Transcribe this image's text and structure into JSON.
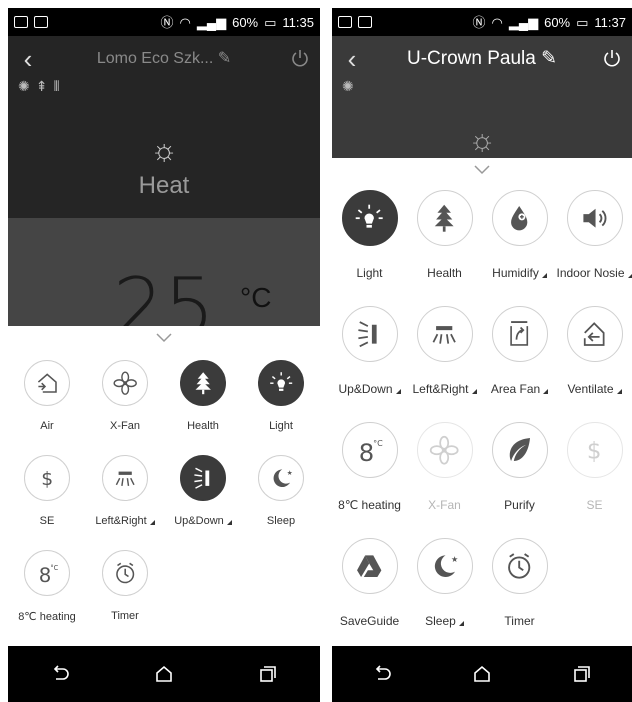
{
  "left": {
    "status": {
      "battery": "60%",
      "time": "11:35"
    },
    "device_title": "Lomo Eco Szk...",
    "mode": "Heat",
    "temperature": {
      "value": "25",
      "unit": "°C"
    },
    "functions": [
      {
        "label": "Air",
        "icon": "air-house-icon",
        "state": "normal"
      },
      {
        "label": "X-Fan",
        "icon": "fan-icon",
        "state": "normal"
      },
      {
        "label": "Health",
        "icon": "tree-icon",
        "state": "active"
      },
      {
        "label": "Light",
        "icon": "bulb-icon",
        "state": "active"
      },
      {
        "label": "SE",
        "icon": "dollar-icon",
        "state": "normal"
      },
      {
        "label": "Left&Right",
        "icon": "swing-horizontal-icon",
        "state": "normal",
        "dropdown": true
      },
      {
        "label": "Up&Down",
        "icon": "swing-vertical-icon",
        "state": "active",
        "dropdown": true
      },
      {
        "label": "Sleep",
        "icon": "moon-icon",
        "state": "normal"
      },
      {
        "label": "8℃ heating",
        "icon": "eight-degree-icon",
        "state": "normal"
      },
      {
        "label": "Timer",
        "icon": "clock-icon",
        "state": "normal"
      }
    ]
  },
  "right": {
    "status": {
      "battery": "60%",
      "time": "11:37"
    },
    "device_title": "U-Crown Paula",
    "functions": [
      {
        "label": "Light",
        "icon": "bulb-icon",
        "state": "active"
      },
      {
        "label": "Health",
        "icon": "tree-icon",
        "state": "normal"
      },
      {
        "label": "Humidify",
        "icon": "drop-icon",
        "state": "normal",
        "dropdown": true
      },
      {
        "label": "Indoor Nosie",
        "icon": "speaker-icon",
        "state": "normal",
        "dropdown": true
      },
      {
        "label": "Up&Down",
        "icon": "swing-vertical-icon",
        "state": "normal",
        "dropdown": true
      },
      {
        "label": "Left&Right",
        "icon": "swing-horizontal-icon",
        "state": "normal",
        "dropdown": true
      },
      {
        "label": "Area Fan",
        "icon": "area-fan-icon",
        "state": "normal",
        "dropdown": true
      },
      {
        "label": "Ventilate",
        "icon": "ventilate-icon",
        "state": "normal",
        "dropdown": true
      },
      {
        "label": "8℃ heating",
        "icon": "eight-degree-icon",
        "state": "normal"
      },
      {
        "label": "X-Fan",
        "icon": "fan-icon",
        "state": "disabled"
      },
      {
        "label": "Purify",
        "icon": "leaf-icon",
        "state": "normal"
      },
      {
        "label": "SE",
        "icon": "dollar-icon",
        "state": "disabled"
      },
      {
        "label": "SaveGuide",
        "icon": "drive-icon",
        "state": "normal"
      },
      {
        "label": "Sleep",
        "icon": "moon-icon",
        "state": "normal",
        "dropdown": true
      },
      {
        "label": "Timer",
        "icon": "clock-icon",
        "state": "normal"
      }
    ]
  },
  "colors": {
    "active": "#3b3b3b",
    "header": "#3a3a3a",
    "border": "#d0d0d0",
    "navbar": "#000000"
  }
}
